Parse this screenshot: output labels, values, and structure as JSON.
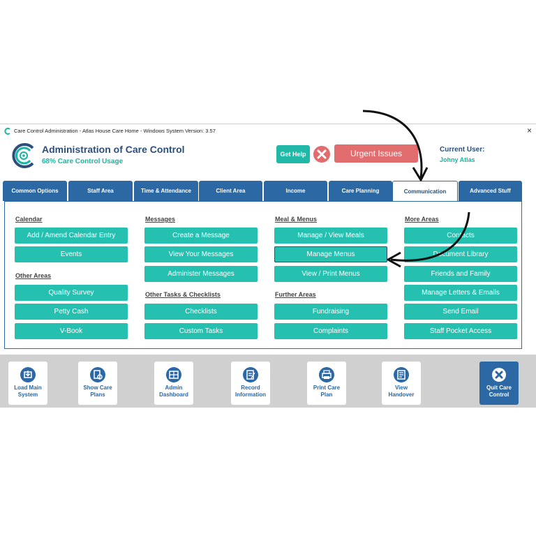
{
  "window": {
    "title": "Care Control Administration - Atlas House Care Home - Windows System Version: 3.57",
    "close_symbol": "×"
  },
  "header": {
    "app_title": "Administration of Care Control",
    "usage": "68% Care Control Usage",
    "help_label": "Get Help",
    "urgent_label": "Urgent Issues",
    "user_label": "Current User:",
    "user_name": "Johny Atlas"
  },
  "tabs": [
    {
      "label": "Common Options"
    },
    {
      "label": "Staff Area"
    },
    {
      "label": "Time & Attendance"
    },
    {
      "label": "Client Area"
    },
    {
      "label": "Income"
    },
    {
      "label": "Care Planning"
    },
    {
      "label": "Communication"
    },
    {
      "label": "Advanced Stuff"
    }
  ],
  "active_tab": "Communication",
  "columns": {
    "c1": {
      "sections": [
        "Calendar",
        "Other Areas"
      ],
      "buttons": [
        "Add / Amend Calendar Entry",
        "Events",
        "Quality Survey",
        "Petty Cash",
        "V-Book"
      ]
    },
    "c2": {
      "sections": [
        "Messages",
        "Other Tasks & Checklists"
      ],
      "buttons": [
        "Create a Message",
        "View Your Messages",
        "Administer Messages",
        "Checklists",
        "Custom Tasks"
      ]
    },
    "c3": {
      "sections": [
        "Meal & Menus",
        "Further Areas"
      ],
      "buttons": [
        "Manage / View Meals",
        "Manage Menus",
        "View / Print Menus",
        "Fundraising",
        "Complaints"
      ]
    },
    "c4": {
      "sections": [
        "More Areas"
      ],
      "buttons": [
        "Contacts",
        "Document Library",
        "Friends and Family",
        "Manage Letters & Emails",
        "Send Email",
        "Staff Pocket Access"
      ]
    }
  },
  "toolbar": [
    {
      "label": "Load Main\nSystem",
      "icon": "load-icon"
    },
    {
      "label": "Show Care\nPlans",
      "icon": "care-plan-icon"
    },
    {
      "label": "Admin\nDashboard",
      "icon": "dashboard-icon"
    },
    {
      "label": "Record\nInformation",
      "icon": "record-icon"
    },
    {
      "label": "Print Care\nPlan",
      "icon": "print-icon"
    },
    {
      "label": "View\nHandover",
      "icon": "handover-icon"
    },
    {
      "label": "Quit Care\nControl",
      "icon": "quit-icon"
    }
  ],
  "colors": {
    "teal": "#25c0b0",
    "navy": "#2b68a4",
    "red": "#e26d6f"
  }
}
